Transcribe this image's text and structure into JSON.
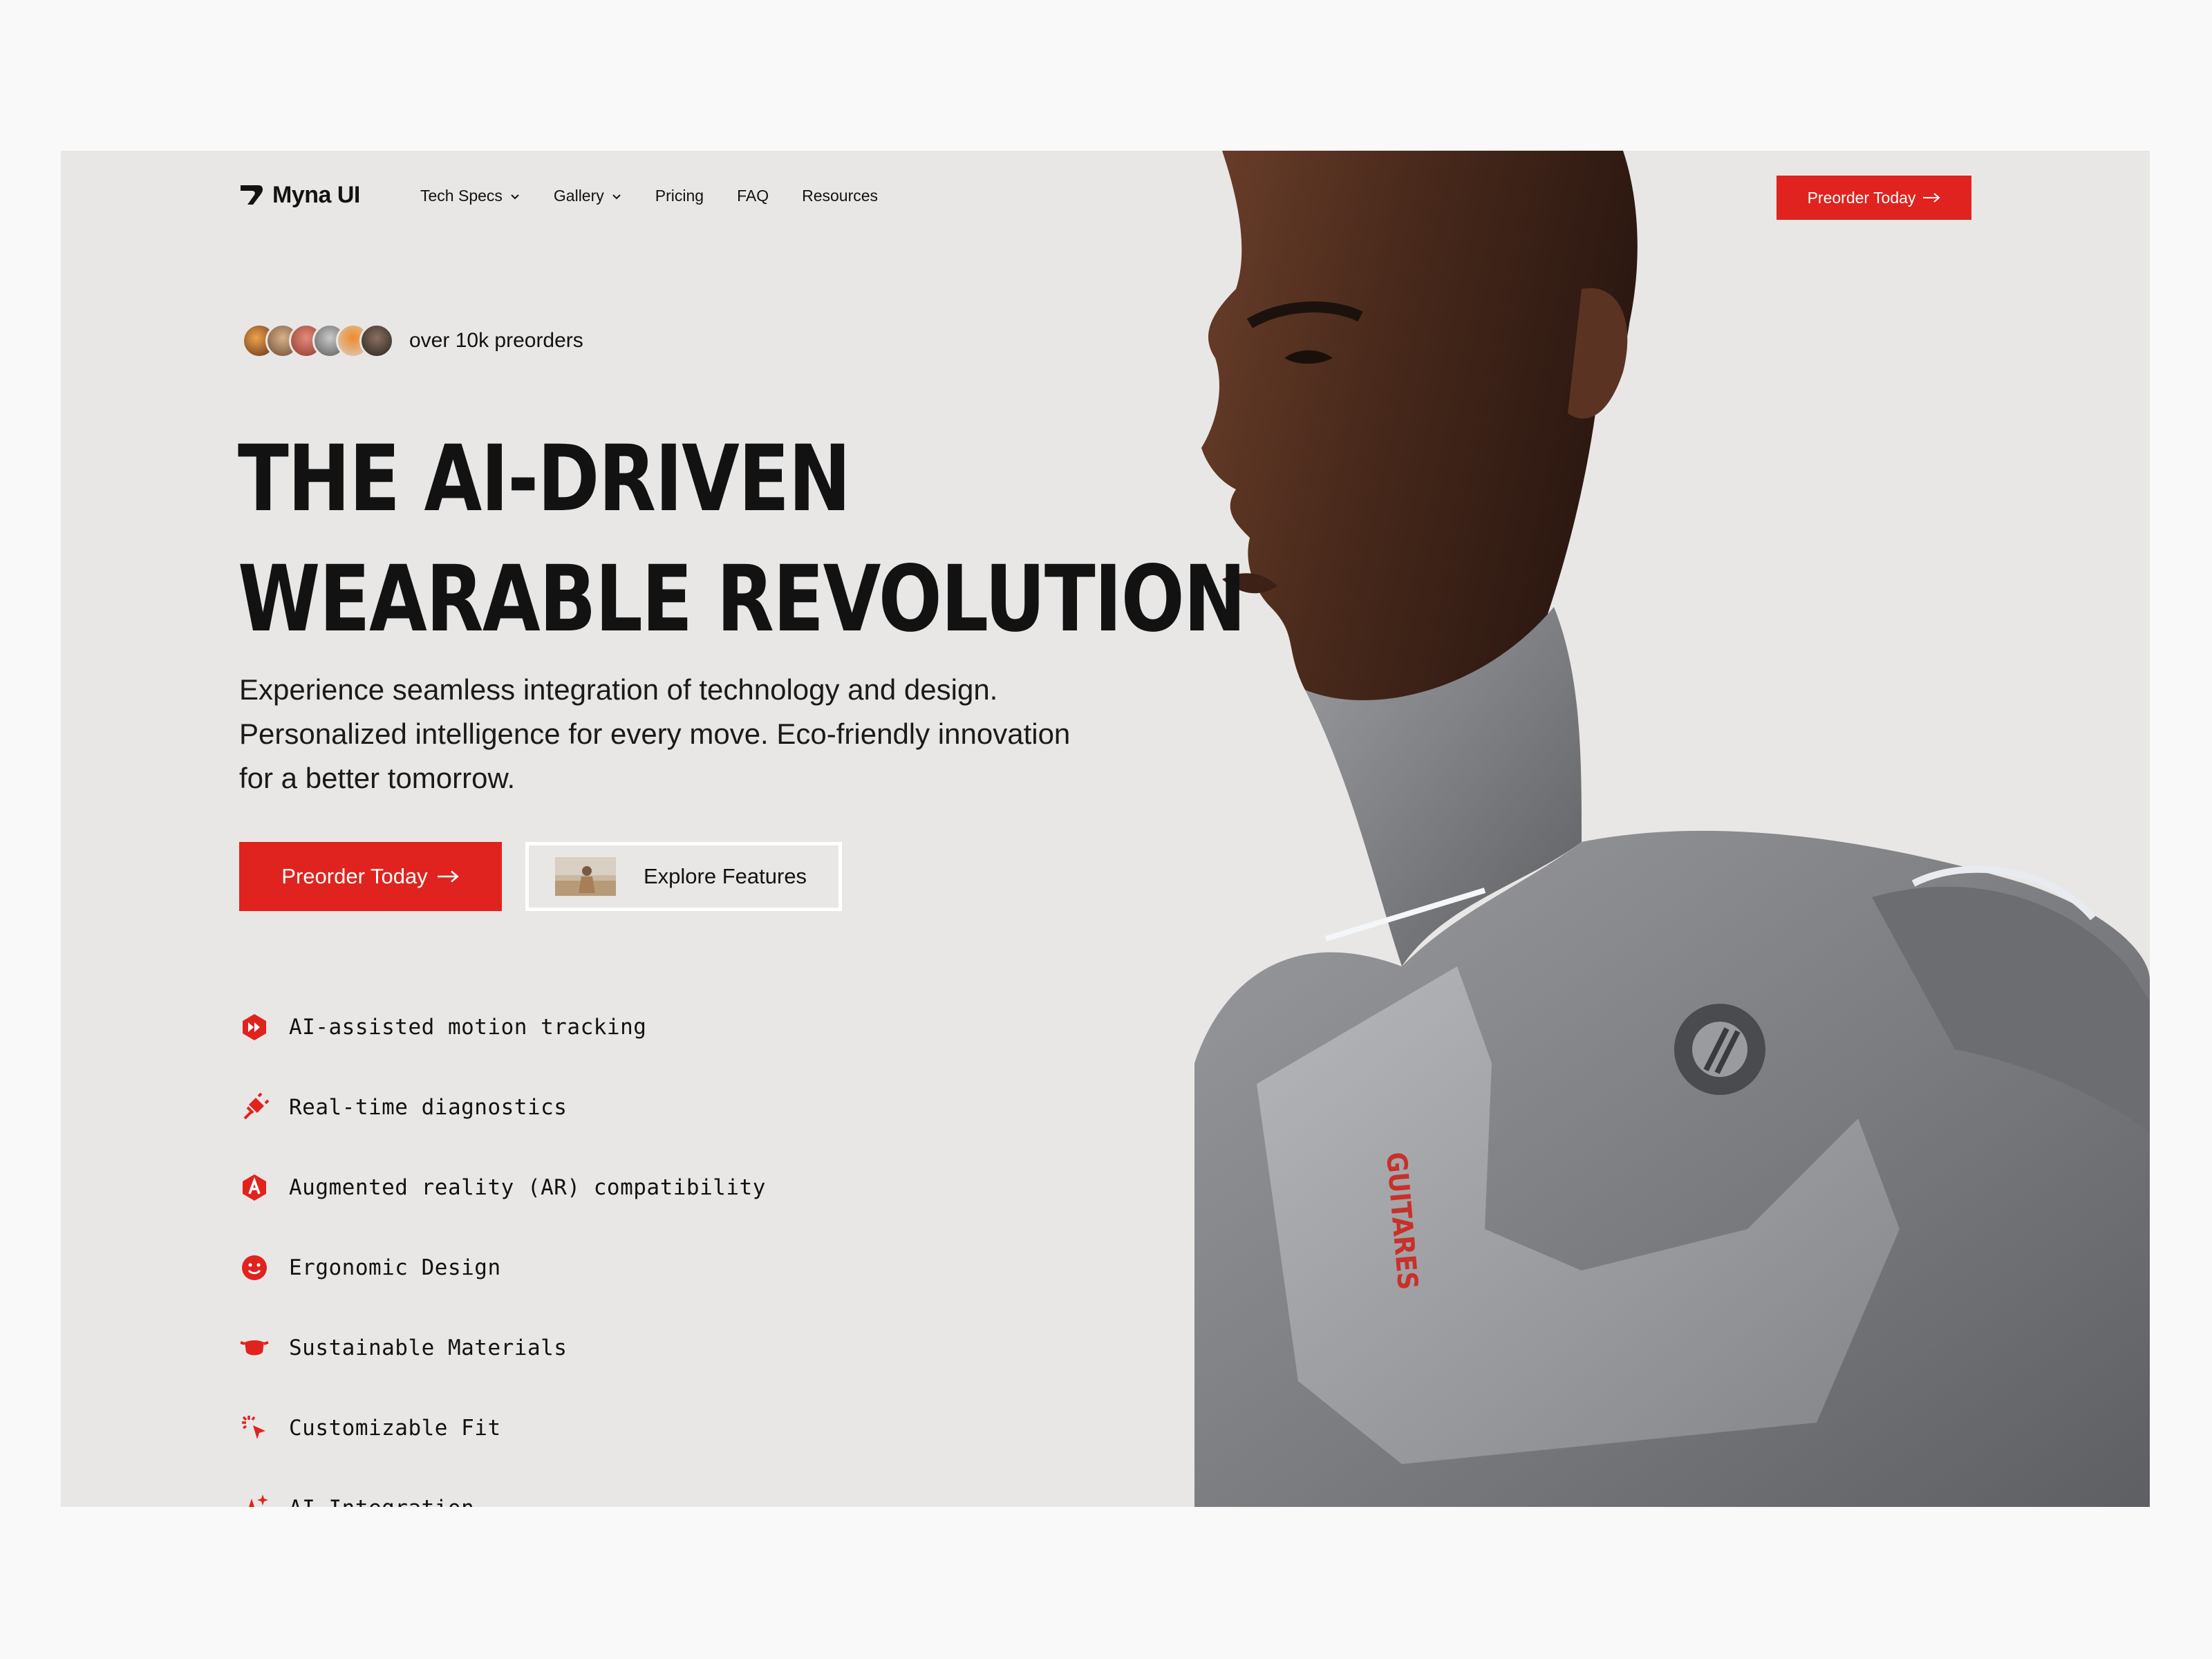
{
  "brand": {
    "name": "Myna UI",
    "accent": "#e0231e",
    "background": "#e9e7e5"
  },
  "nav": {
    "items": [
      {
        "label": "Tech Specs",
        "has_dropdown": true
      },
      {
        "label": "Gallery",
        "has_dropdown": true
      },
      {
        "label": "Pricing",
        "has_dropdown": false
      },
      {
        "label": "FAQ",
        "has_dropdown": false
      },
      {
        "label": "Resources",
        "has_dropdown": false
      }
    ],
    "cta_label": "Preorder Today"
  },
  "hero": {
    "preorders_text": "over 10k preorders",
    "headline_line1": "THE AI-DRIVEN",
    "headline_line2": "WEARABLE REVOLUTION",
    "subtext": "Experience seamless integration of technology and design. Personalized intelligence for every move. Eco-friendly innovation for a better tomorrow.",
    "primary_cta": "Preorder Today",
    "secondary_cta": "Explore Features",
    "suit_lettering": "GUITARES"
  },
  "features": [
    {
      "label": "AI-assisted motion tracking",
      "icon": "fast-forward-hexagon-icon"
    },
    {
      "label": "Real-time diagnostics",
      "icon": "plug-icon"
    },
    {
      "label": "Augmented reality (AR) compatibility",
      "icon": "ar-hexagon-icon"
    },
    {
      "label": "Ergonomic Design",
      "icon": "smile-face-icon"
    },
    {
      "label": "Sustainable Materials",
      "icon": "face-mask-icon"
    },
    {
      "label": "Customizable Fit",
      "icon": "cursor-click-icon"
    },
    {
      "label": "AI Integration",
      "icon": "sparkles-icon"
    }
  ]
}
